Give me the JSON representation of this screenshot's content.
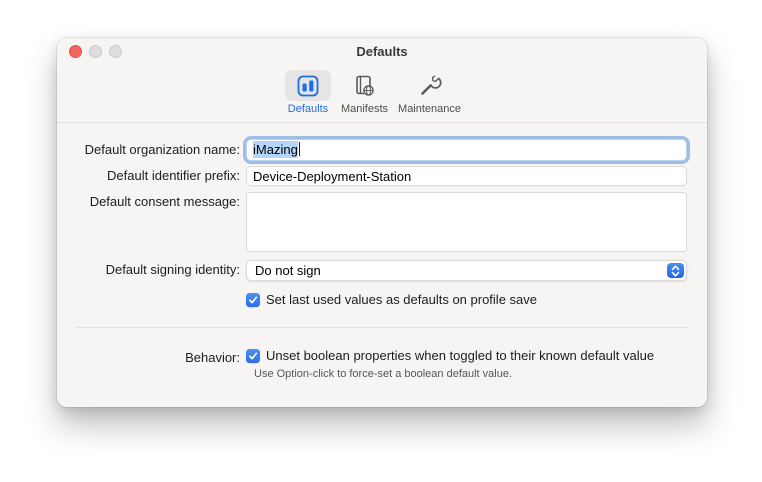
{
  "window": {
    "title": "Defaults"
  },
  "toolbar": {
    "items": [
      {
        "label": "Defaults",
        "icon": "sliders-icon",
        "selected": true
      },
      {
        "label": "Manifests",
        "icon": "book-globe-icon",
        "selected": false
      },
      {
        "label": "Maintenance",
        "icon": "wrench-icon",
        "selected": false
      }
    ]
  },
  "form": {
    "organization": {
      "label": "Default organization name:",
      "value": "iMazing"
    },
    "prefix": {
      "label": "Default identifier prefix:",
      "value": "Device-Deployment-Station"
    },
    "consent": {
      "label": "Default consent message:",
      "value": ""
    },
    "signing": {
      "label": "Default signing identity:",
      "value": "Do not sign"
    },
    "save_defaults_checkbox": {
      "label": "Set last used values as defaults on profile save",
      "checked": true
    }
  },
  "behavior": {
    "label": "Behavior:",
    "checkbox": {
      "label": "Unset boolean properties when toggled to their known default value",
      "checked": true
    },
    "helper": "Use Option-click to force-set a boolean default value."
  },
  "colors": {
    "accent": "#2e7ce4",
    "selection": "#b3d6f9",
    "focus_ring": "#5a90d8",
    "traffic_red": "#f3645c"
  }
}
